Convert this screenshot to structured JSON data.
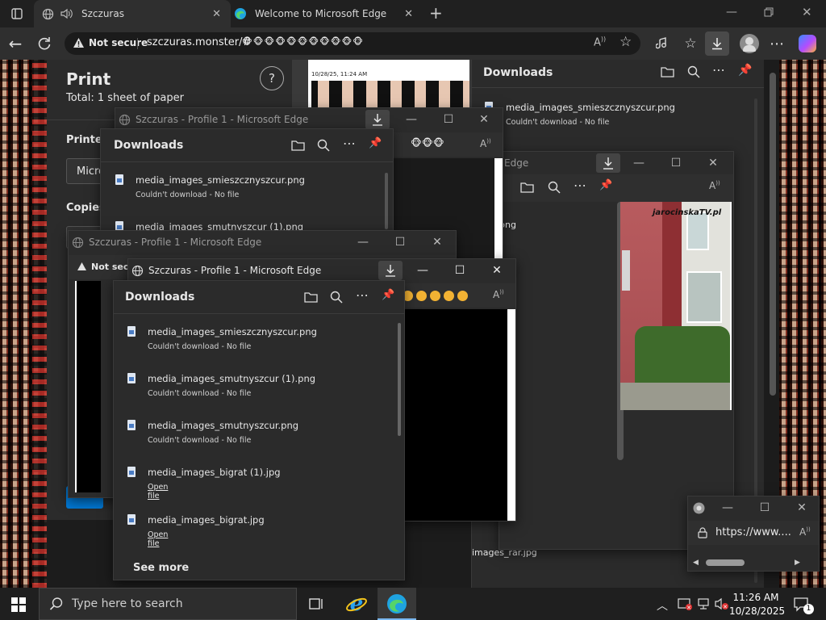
{
  "colors": {
    "accent": "#0078d4",
    "panel_bg": "#2b2b2b",
    "toolbar_bg": "#2f2f2f",
    "pink_wall": "#b85b5e"
  },
  "tabs": [
    {
      "label": "Szczuras",
      "icon": "globe-icon",
      "audio_icon": "speaker-icon"
    },
    {
      "label": "Welcome to Microsoft Edge",
      "icon": "edge-icon"
    }
  ],
  "address": {
    "security": "Not secure",
    "url": "szczuras.monster/#",
    "url_emoji": "🐵🐵🐵🐵🐵🐵🐵🐵🐵🐵🐵"
  },
  "print": {
    "title": "Print",
    "total": "Total: 1 sheet of paper",
    "printer_label": "Printer",
    "printer_value": "Micro",
    "copies_label": "Copies",
    "preview_date": "10/28/25, 11:24 AM",
    "help": "?"
  },
  "main_downloads": {
    "title": "Downloads",
    "item": {
      "name": "media_images_smieszcznyszcur.png",
      "status": "Couldn't download - No file"
    },
    "partial_name": "png",
    "partial_status": "Download - No file",
    "partial_name2": "images_rar.jpg"
  },
  "window_a": {
    "title": "Szczuras - Profile 1 - Microsoft Edge",
    "downloads_title": "Downloads",
    "items": [
      {
        "name": "media_images_smieszcznyszcur.png",
        "status": "Couldn't download - No file"
      },
      {
        "name": "media_images_smutnyszcur (1).png",
        "status": ""
      }
    ]
  },
  "window_b": {
    "title": "Szczuras - Profile 1 - Microsoft Edge",
    "security": "Not secu"
  },
  "window_c": {
    "title": "Szczuras - Profile 1 - Microsoft Edge",
    "downloads_title": "Downloads",
    "items": [
      {
        "name": "media_images_smieszcznyszcur.png",
        "status": "Couldn't download - No file",
        "link": ""
      },
      {
        "name": "media_images_smutnyszcur (1).png",
        "status": "Couldn't download - No file",
        "link": ""
      },
      {
        "name": "media_images_smutnyszcur.png",
        "status": "Couldn't download - No file",
        "link": ""
      },
      {
        "name": "media_images_bigrat (1).jpg",
        "status": "",
        "link": "Open file"
      },
      {
        "name": "media_images_bigrat.jpg",
        "status": "",
        "link": "Open file"
      }
    ],
    "see_more": "See more"
  },
  "window_d": {
    "title": "Edge",
    "watermark": "jarocinskaTV.pl"
  },
  "window_e": {
    "url": "https://www...."
  },
  "taskbar": {
    "search_placeholder": "Type here to search",
    "time": "11:26 AM",
    "date": "10/28/2025",
    "notification_count": "1"
  }
}
